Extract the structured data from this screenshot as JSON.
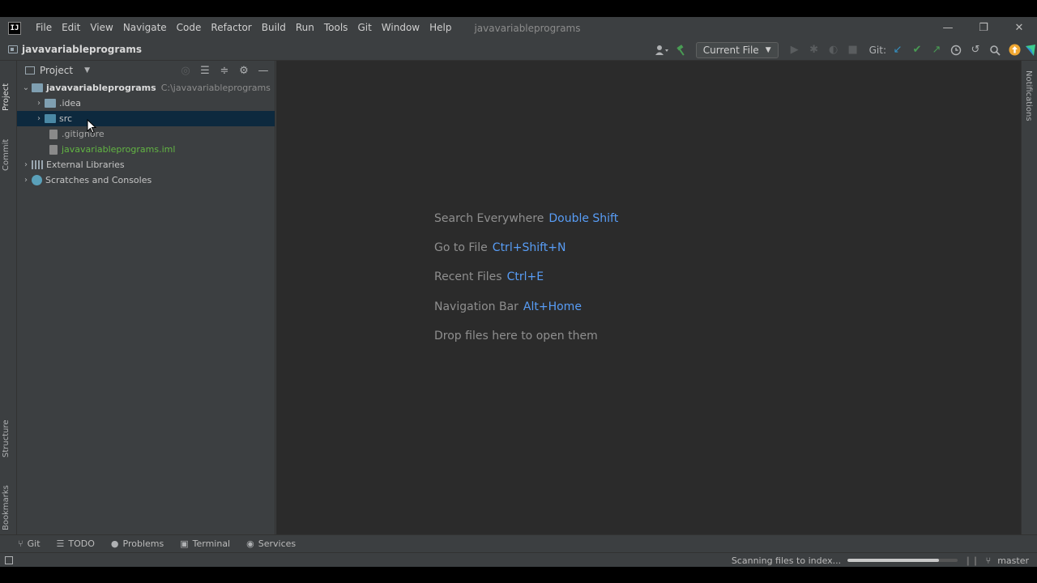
{
  "menubar": {
    "logo": "IJ",
    "items": [
      "File",
      "Edit",
      "View",
      "Navigate",
      "Code",
      "Refactor",
      "Build",
      "Run",
      "Tools",
      "Git",
      "Window",
      "Help"
    ],
    "project_name": "javavariableprograms"
  },
  "window_controls": {
    "minimize": "—",
    "restore": "❐",
    "close": "✕"
  },
  "navbar": {
    "project_title": "javavariableprograms",
    "run_config": "Current File",
    "git_label": "Git:"
  },
  "left_stripe": {
    "project": "Project",
    "commit": "Commit",
    "structure": "Structure",
    "bookmarks": "Bookmarks"
  },
  "right_stripe": {
    "notifications": "Notifications"
  },
  "project_panel": {
    "title": "Project",
    "tree": {
      "root_name": "javavariableprograms",
      "root_path": "C:\\javavariableprograms",
      "idea": ".idea",
      "src": "src",
      "gitignore": ".gitignore",
      "iml": "javavariableprograms.iml",
      "external_libraries": "External Libraries",
      "scratches": "Scratches and Consoles"
    }
  },
  "editor": {
    "hints": [
      {
        "label": "Search Everywhere",
        "shortcut": "Double Shift"
      },
      {
        "label": "Go to File",
        "shortcut": "Ctrl+Shift+N"
      },
      {
        "label": "Recent Files",
        "shortcut": "Ctrl+E"
      },
      {
        "label": "Navigation Bar",
        "shortcut": "Alt+Home"
      },
      {
        "label": "Drop files here to open them",
        "shortcut": ""
      }
    ]
  },
  "bottom_tools": [
    "Git",
    "TODO",
    "Problems",
    "Terminal",
    "Services"
  ],
  "status": {
    "indexing_text": "Scanning files to index...",
    "progress_fraction": 0.83,
    "branch": "master"
  },
  "icons": {
    "git_update": "git-update-icon",
    "git_commit": "git-commit-icon",
    "git_push": "git-push-icon"
  },
  "colors": {
    "accent_link": "#589df6",
    "selection": "#0d293e",
    "vcs_added_green": "#62b543",
    "git_update_blue": "#3592c4",
    "git_commit_green": "#499c54"
  }
}
